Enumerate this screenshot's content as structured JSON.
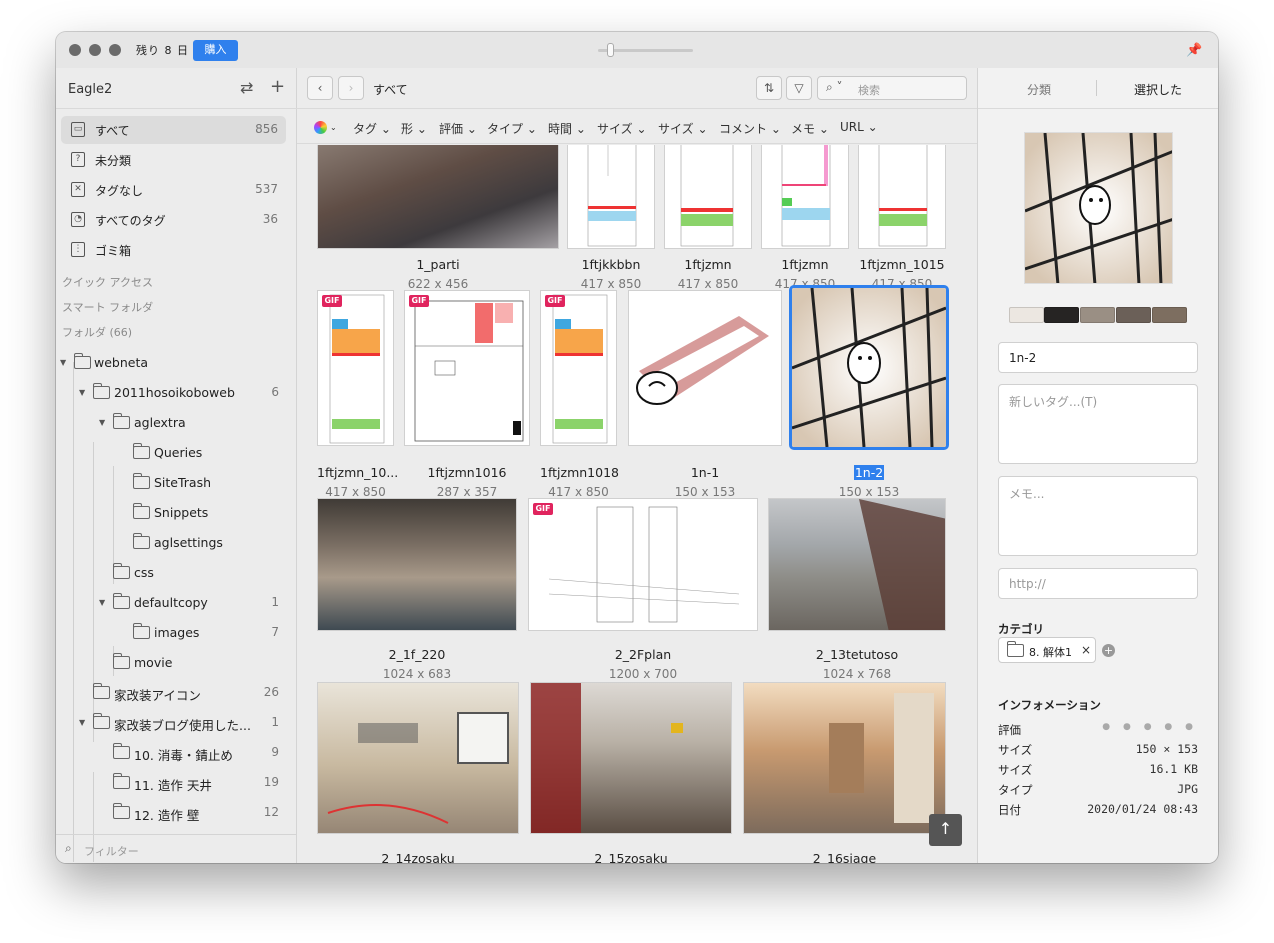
{
  "titlebar": {
    "trial": "残り 8 日",
    "buy": "購入"
  },
  "sidebar": {
    "library": "Eagle2",
    "nav": [
      {
        "label": "すべて",
        "count": "856",
        "icon": "inbox-icon"
      },
      {
        "label": "未分類",
        "count": "",
        "icon": "question-icon"
      },
      {
        "label": "タグなし",
        "count": "537",
        "icon": "untagged-icon"
      },
      {
        "label": "すべてのタグ",
        "count": "36",
        "icon": "tags-icon"
      },
      {
        "label": "ゴミ箱",
        "count": "",
        "icon": "trash-icon"
      }
    ],
    "sections": {
      "quick": "クイック アクセス",
      "smart": "スマート フォルダ",
      "folders": "フォルダ (66)"
    },
    "folders": [
      {
        "label": "webneta",
        "count": ""
      },
      {
        "label": "2011hosoikoboweb",
        "count": "6"
      },
      {
        "label": "aglextra",
        "count": ""
      },
      {
        "label": "Queries",
        "count": ""
      },
      {
        "label": "SiteTrash",
        "count": ""
      },
      {
        "label": "Snippets",
        "count": ""
      },
      {
        "label": "aglsettings",
        "count": ""
      },
      {
        "label": "css",
        "count": ""
      },
      {
        "label": "defaultcopy",
        "count": "1"
      },
      {
        "label": "images",
        "count": "7"
      },
      {
        "label": "movie",
        "count": ""
      },
      {
        "label": "家改装アイコン",
        "count": "26"
      },
      {
        "label": "家改装ブログ使用した...",
        "count": "1"
      },
      {
        "label": "10. 消毒・錆止め",
        "count": "9"
      },
      {
        "label": "11. 造作 天井",
        "count": "19"
      },
      {
        "label": "12. 造作 壁",
        "count": "12"
      }
    ],
    "filter_placeholder": "フィルター"
  },
  "main": {
    "breadcrumb": "すべて",
    "search_placeholder": "検索",
    "filters": [
      "タグ",
      "形",
      "評価",
      "タイプ",
      "時間",
      "サイズ",
      "サイズ",
      "コメント",
      "メモ",
      "URL"
    ],
    "items": [
      {
        "name": "1_parti",
        "size": "622 x 456"
      },
      {
        "name": "1ftjkkbbn",
        "size": "417 x 850"
      },
      {
        "name": "1ftjzmn",
        "size": "417 x 850"
      },
      {
        "name": "1ftjzmn",
        "size": "417 x 850"
      },
      {
        "name": "1ftjzmn_1015",
        "size": "417 x 850"
      },
      {
        "name": "1ftjzmn_10...",
        "size": "417 x 850"
      },
      {
        "name": "1ftjzmn1016",
        "size": "287 x 357"
      },
      {
        "name": "1ftjzmn1018",
        "size": "417 x 850"
      },
      {
        "name": "1n-1",
        "size": "150 x 153"
      },
      {
        "name": "1n-2",
        "size": "150 x 153"
      },
      {
        "name": "2_1f_220",
        "size": "1024 x 683"
      },
      {
        "name": "2_2Fplan",
        "size": "1200 x 700"
      },
      {
        "name": "2_13tetutoso",
        "size": "1024 x 768"
      },
      {
        "name": "2_14zosaku",
        "size": ""
      },
      {
        "name": "2_15zosaku",
        "size": ""
      },
      {
        "name": "2_16siage",
        "size": ""
      }
    ],
    "gif_badge": "GIF"
  },
  "inspector": {
    "tabs": [
      "分類",
      "選択した"
    ],
    "palette": [
      "#ece7e1",
      "#262423",
      "#9a8f84",
      "#6b6058",
      "#7d6e60"
    ],
    "name_value": "1n-2",
    "tags_placeholder": "新しいタグ...(T)",
    "memo_placeholder": "メモ...",
    "url_placeholder": "http://",
    "category_title": "カテゴリ",
    "category_chip": "8. 解体1",
    "info_title": "インフォメーション",
    "info": [
      {
        "k": "評価",
        "v": ""
      },
      {
        "k": "サイズ",
        "v": "150 × 153"
      },
      {
        "k": "サイズ",
        "v": "16.1 KB"
      },
      {
        "k": "タイプ",
        "v": "JPG"
      },
      {
        "k": "日付",
        "v": "2020/01/24 08:43"
      }
    ],
    "rating_stars": "● ● ● ● ●"
  },
  "colors": {
    "accent": "#2f80ed",
    "gif": "#e0245e"
  }
}
